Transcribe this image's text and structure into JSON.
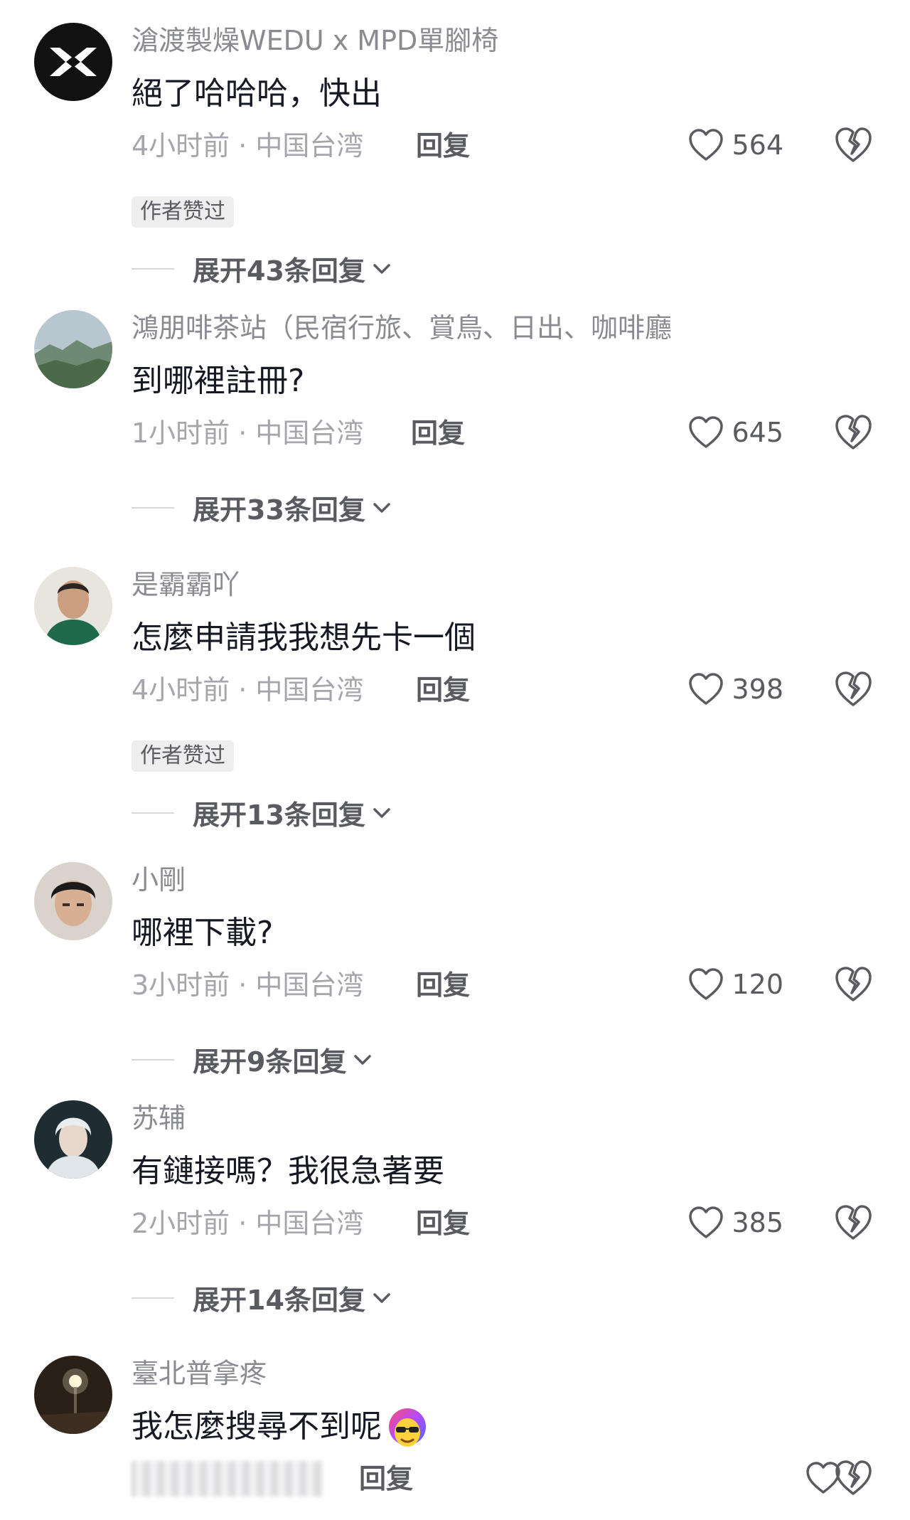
{
  "comments": [
    {
      "username": "滄渡製燥WEDU x MPD單腳椅",
      "text": "絕了哈哈哈，快出",
      "meta": "4小时前 · 中国台湾",
      "reply_label": "回复",
      "likes": "564",
      "badge": "作者赞过",
      "expand_label": "展开43条回复"
    },
    {
      "username": "鴻朋啡茶站（民宿行旅、賞鳥、日出、咖啡廳",
      "text": "到哪裡註冊?",
      "meta": "1小时前 · 中国台湾",
      "reply_label": "回复",
      "likes": "645",
      "expand_label": "展开33条回复"
    },
    {
      "username": "是霸霸吖",
      "text": "怎麼申請我我想先卡一個",
      "meta": "4小时前 · 中国台湾",
      "reply_label": "回复",
      "likes": "398",
      "badge": "作者赞过",
      "expand_label": "展开13条回复"
    },
    {
      "username": "小剛",
      "text": "哪裡下載?",
      "meta": "3小时前 · 中国台湾",
      "reply_label": "回复",
      "likes": "120",
      "expand_label": "展开9条回复"
    },
    {
      "username": "苏辅",
      "text": "有鏈接嗎？我很急著要",
      "meta": "2小时前 · 中国台湾",
      "reply_label": "回复",
      "likes": "385",
      "expand_label": "展开14条回复"
    },
    {
      "username": "臺北普拿疼",
      "text": "我怎麼搜尋不到呢",
      "reply_label": "回复",
      "emoji": "cool-face-emoji"
    }
  ],
  "icons": {
    "like": "heart-outline-icon",
    "dislike": "broken-heart-icon",
    "expand": "chevron-down-icon"
  }
}
